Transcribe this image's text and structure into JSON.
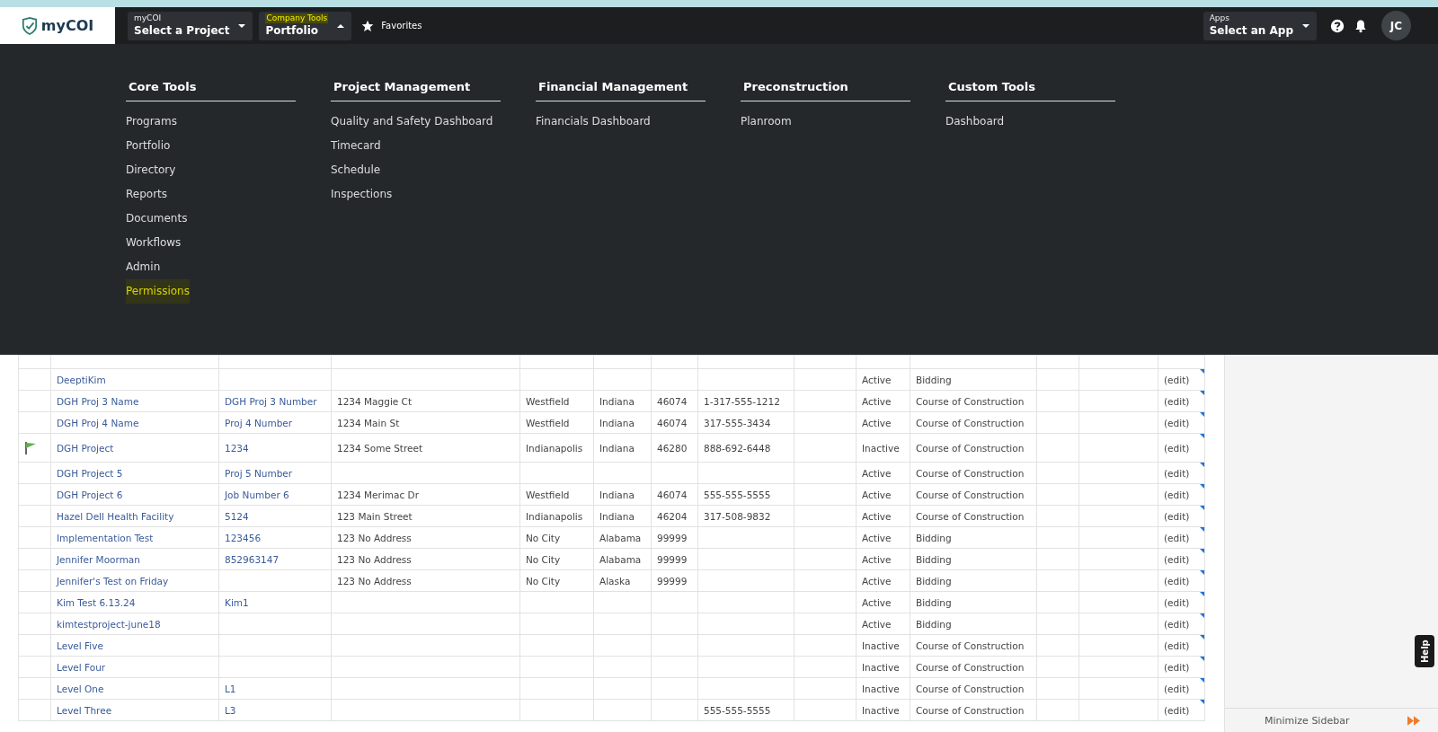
{
  "nav": {
    "logo": "myCOI",
    "dropdowns": [
      {
        "label": "myCOI",
        "value": "Select a Project",
        "highlighted": false,
        "expanded": false
      },
      {
        "label": "Company Tools",
        "value": "Portfolio",
        "highlighted": true,
        "expanded": true
      }
    ],
    "favorites": "Favorites",
    "apps": {
      "label": "Apps",
      "value": "Select an App"
    },
    "avatar": "JC"
  },
  "menu": [
    {
      "heading": "Core Tools",
      "items": [
        {
          "label": "Programs",
          "highlighted": false
        },
        {
          "label": "Portfolio",
          "highlighted": false
        },
        {
          "label": "Directory",
          "highlighted": false
        },
        {
          "label": "Reports",
          "highlighted": false
        },
        {
          "label": "Documents",
          "highlighted": false
        },
        {
          "label": "Workflows",
          "highlighted": false
        },
        {
          "label": "Admin",
          "highlighted": false
        },
        {
          "label": "Permissions",
          "highlighted": true
        }
      ]
    },
    {
      "heading": "Project Management",
      "items": [
        {
          "label": "Quality and Safety Dashboard",
          "highlighted": false
        },
        {
          "label": "Timecard",
          "highlighted": false
        },
        {
          "label": "Schedule",
          "highlighted": false
        },
        {
          "label": "Inspections",
          "highlighted": false
        }
      ]
    },
    {
      "heading": "Financial Management",
      "items": [
        {
          "label": "Financials Dashboard",
          "highlighted": false
        }
      ]
    },
    {
      "heading": "Preconstruction",
      "items": [
        {
          "label": "Planroom",
          "highlighted": false
        }
      ]
    },
    {
      "heading": "Custom Tools",
      "items": [
        {
          "label": "Dashboard",
          "highlighted": false
        }
      ]
    }
  ],
  "table": {
    "rows": [
      {
        "flagged": false,
        "cells": [
          "DeeptiKim",
          "",
          "",
          "",
          "",
          "",
          "",
          "",
          "Active",
          "Bidding",
          "",
          "",
          "(edit)"
        ]
      },
      {
        "flagged": false,
        "cells": [
          "DGH Proj 3 Name",
          "DGH Proj 3 Number",
          "1234 Maggie Ct",
          "Westfield",
          "Indiana",
          "46074",
          "1-317-555-1212",
          "",
          "Active",
          "Course of Construction",
          "",
          "",
          "(edit)"
        ]
      },
      {
        "flagged": false,
        "cells": [
          "DGH Proj 4 Name",
          "Proj 4 Number",
          "1234 Main St",
          "Westfield",
          "Indiana",
          "46074",
          "317-555-3434",
          "",
          "Active",
          "Course of Construction",
          "",
          "",
          "(edit)"
        ]
      },
      {
        "flagged": true,
        "cells": [
          "DGH Project",
          "1234",
          "1234 Some Street",
          "Indianapolis",
          "Indiana",
          "46280",
          "888-692-6448",
          "",
          "Inactive",
          "Course of Construction",
          "",
          "",
          "(edit)"
        ]
      },
      {
        "flagged": false,
        "cells": [
          "DGH Project 5",
          "Proj 5 Number",
          "",
          "",
          "",
          "",
          "",
          "",
          "Active",
          "Course of Construction",
          "",
          "",
          "(edit)"
        ]
      },
      {
        "flagged": false,
        "cells": [
          "DGH Project 6",
          "Job Number 6",
          "1234 Merimac Dr",
          "Westfield",
          "Indiana",
          "46074",
          "555-555-5555",
          "",
          "Active",
          "Course of Construction",
          "",
          "",
          "(edit)"
        ]
      },
      {
        "flagged": false,
        "cells": [
          "Hazel Dell Health Facility",
          "5124",
          "123 Main Street",
          "Indianapolis",
          "Indiana",
          "46204",
          "317-508-9832",
          "",
          "Active",
          "Course of Construction",
          "",
          "",
          "(edit)"
        ]
      },
      {
        "flagged": false,
        "cells": [
          "Implementation Test",
          "123456",
          "123 No Address",
          "No City",
          "Alabama",
          "99999",
          "",
          "",
          "Active",
          "Bidding",
          "",
          "",
          "(edit)"
        ]
      },
      {
        "flagged": false,
        "cells": [
          "Jennifer Moorman",
          "852963147",
          "123 No Address",
          "No City",
          "Alabama",
          "99999",
          "",
          "",
          "Active",
          "Bidding",
          "",
          "",
          "(edit)"
        ]
      },
      {
        "flagged": false,
        "cells": [
          "Jennifer's Test on Friday",
          "",
          "123 No Address",
          "No City",
          "Alaska",
          "99999",
          "",
          "",
          "Active",
          "Bidding",
          "",
          "",
          "(edit)"
        ]
      },
      {
        "flagged": false,
        "cells": [
          "Kim Test 6.13.24",
          "Kim1",
          "",
          "",
          "",
          "",
          "",
          "",
          "Active",
          "Bidding",
          "",
          "",
          "(edit)"
        ]
      },
      {
        "flagged": false,
        "cells": [
          "kimtestproject-june18",
          "",
          "",
          "",
          "",
          "",
          "",
          "",
          "Active",
          "Bidding",
          "",
          "",
          "(edit)"
        ]
      },
      {
        "flagged": false,
        "cells": [
          "Level Five",
          "",
          "",
          "",
          "",
          "",
          "",
          "",
          "Inactive",
          "Course of Construction",
          "",
          "",
          "(edit)"
        ]
      },
      {
        "flagged": false,
        "cells": [
          "Level Four",
          "",
          "",
          "",
          "",
          "",
          "",
          "",
          "Inactive",
          "Course of Construction",
          "",
          "",
          "(edit)"
        ]
      },
      {
        "flagged": false,
        "cells": [
          "Level One",
          "L1",
          "",
          "",
          "",
          "",
          "",
          "",
          "Inactive",
          "Course of Construction",
          "",
          "",
          "(edit)"
        ]
      },
      {
        "flagged": false,
        "cells": [
          "Level Three",
          "L3",
          "",
          "",
          "",
          "",
          "555-555-5555",
          "",
          "Inactive",
          "Course of Construction",
          "",
          "",
          "(edit)"
        ]
      }
    ]
  },
  "sidebar": {
    "help": "Help",
    "minimize": "Minimize Sidebar"
  }
}
